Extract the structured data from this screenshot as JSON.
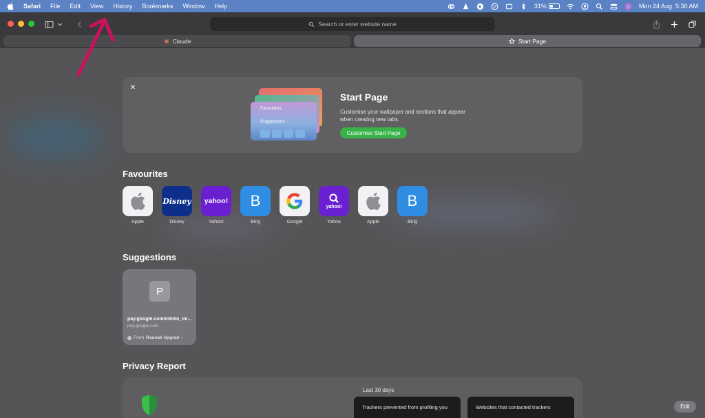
{
  "menubar": {
    "app_name": "Safari",
    "items": [
      "File",
      "Edit",
      "View",
      "History",
      "Bookmarks",
      "Window",
      "Help"
    ],
    "battery_percent": "31%",
    "datetime": "Mon 24 Aug  5:30 AM",
    "status_icons": [
      "creative-cloud-icon",
      "vlc-icon",
      "app-icon",
      "circle-p-icon",
      "window-icon",
      "bluetooth-icon",
      "battery-icon",
      "wifi-icon",
      "user-icon",
      "search-icon",
      "control-center-icon",
      "siri-icon"
    ]
  },
  "toolbar": {
    "search_placeholder": "Search or enter website name"
  },
  "tabs": [
    {
      "label": "Claude",
      "icon": "claude-icon",
      "active": false
    },
    {
      "label": "Start Page",
      "icon": "star-icon",
      "active": true
    }
  ],
  "promo": {
    "title": "Start Page",
    "description": "Customise your wallpaper and sections that appear when creating new tabs.",
    "button_label": "Customise Start Page",
    "art_labels": {
      "favourites": "Favourites",
      "suggestions": "Suggestions"
    }
  },
  "favourites": {
    "title": "Favourites",
    "items": [
      {
        "label": "Apple",
        "icon": "apple-icon"
      },
      {
        "label": "Disney",
        "icon": "disney-icon",
        "tile_text": "Disney"
      },
      {
        "label": "Yahoo!",
        "icon": "yahoo-icon",
        "tile_text": "yahoo!"
      },
      {
        "label": "Bing",
        "icon": "bing-icon",
        "tile_text": "B"
      },
      {
        "label": "Google",
        "icon": "google-icon"
      },
      {
        "label": "Yahoo",
        "icon": "yahoo-search-icon",
        "tile_text": "yahoo!"
      },
      {
        "label": "Apple",
        "icon": "apple-icon"
      },
      {
        "label": "Bing",
        "icon": "bing-icon",
        "tile_text": "B"
      }
    ]
  },
  "suggestions": {
    "title": "Suggestions",
    "items": [
      {
        "letter": "P",
        "title": "pay.google.com/intl/en_in/...",
        "url": "pay.google.com",
        "from_prefix": "From",
        "from_name": "Raunak Upgrad"
      }
    ]
  },
  "privacy": {
    "title": "Privacy Report",
    "period": "Last 30 days",
    "cards": [
      "Trackers prevented from profiling you",
      "Websites that contacted trackers"
    ]
  },
  "edit_label": "Edit",
  "colors": {
    "menubar": "#5a82c4",
    "accent_green": "#3ab24a",
    "annotation_arrow": "#c8135c"
  }
}
